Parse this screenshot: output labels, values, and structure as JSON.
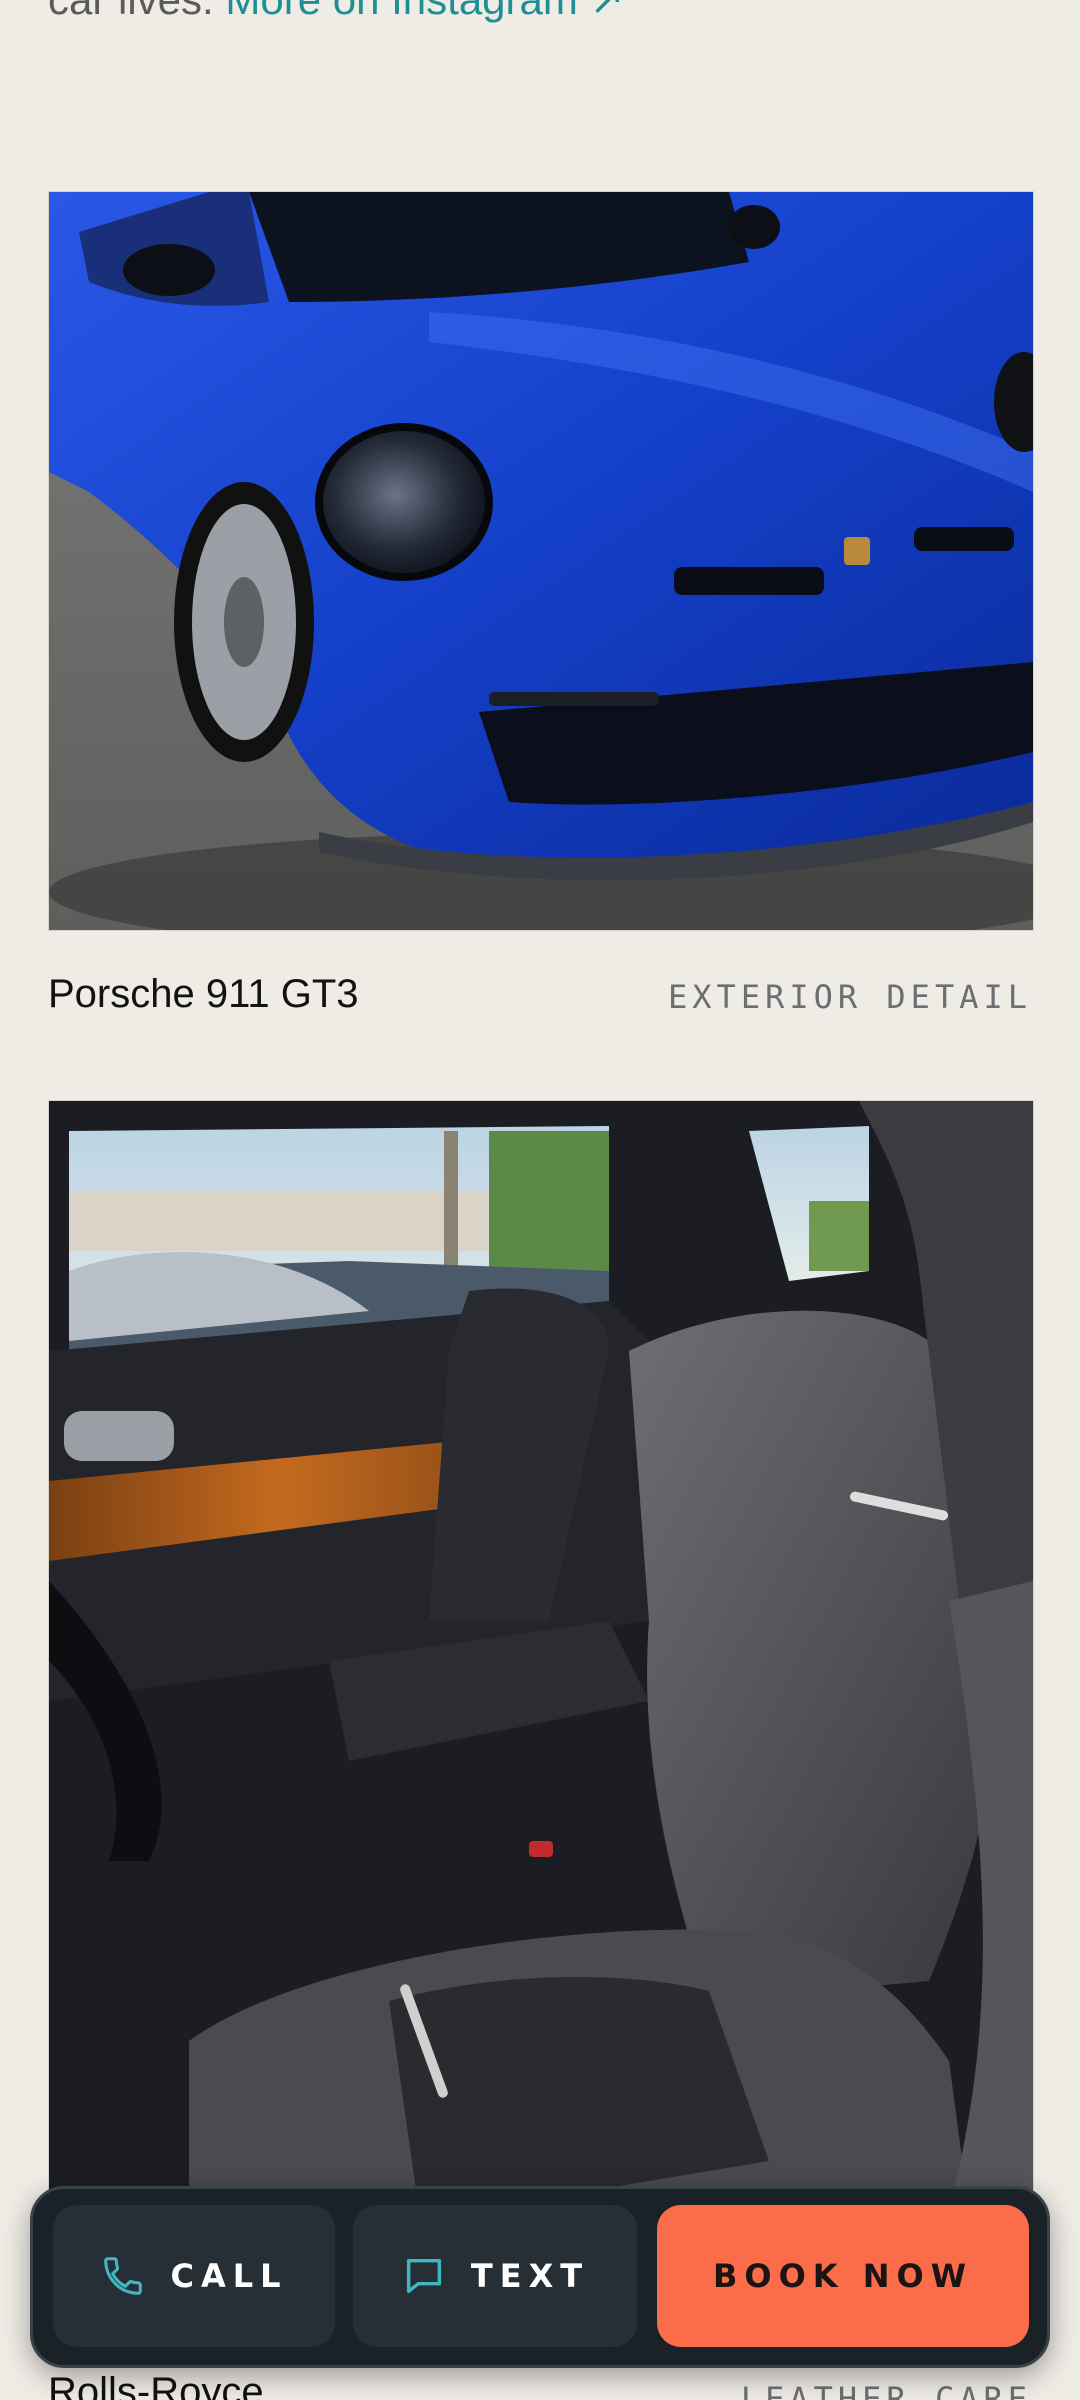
{
  "intro": {
    "text_prefix": "car lives.",
    "instagram_link": "More on Instagram ↗"
  },
  "gallery": [
    {
      "title": "Porsche 911 GT3",
      "tag": "EXTERIOR DETAIL"
    },
    {
      "title": "Rolls-Royce",
      "tag": "LEATHER CARE"
    }
  ],
  "action_bar": {
    "call_label": "CALL",
    "text_label": "TEXT",
    "book_label": "BOOK NOW"
  },
  "icons": {
    "call": "phone-icon",
    "text": "chat-bubble-icon"
  },
  "colors": {
    "background": "#efebe5",
    "accent_link": "#1f8f96",
    "book_button": "#fb6c4b",
    "action_bar": "#1b2227",
    "icon_teal": "#3fb8c4"
  }
}
